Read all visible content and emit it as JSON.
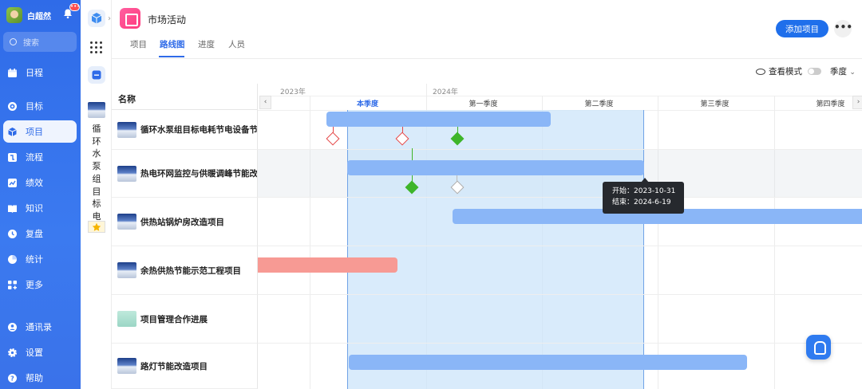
{
  "sidebar": {
    "user_name": "白超然",
    "notification_badge": "•••",
    "search_placeholder": "搜索",
    "items": [
      {
        "label": "日程",
        "icon": "calendar-icon"
      },
      {
        "label": "目标",
        "icon": "target-icon"
      },
      {
        "label": "项目",
        "icon": "cube-icon",
        "active": true
      },
      {
        "label": "流程",
        "icon": "flow-icon"
      },
      {
        "label": "绩效",
        "icon": "performance-icon"
      },
      {
        "label": "知识",
        "icon": "book-icon"
      },
      {
        "label": "复盘",
        "icon": "review-icon"
      },
      {
        "label": "统计",
        "icon": "pie-chart-icon"
      },
      {
        "label": "更多",
        "icon": "grid-plus-icon"
      },
      {
        "label": "通讯录",
        "icon": "contacts-icon"
      },
      {
        "label": "设置",
        "icon": "gear-icon"
      },
      {
        "label": "帮助",
        "icon": "help-icon"
      }
    ]
  },
  "project_column": {
    "vertical_title": "循环水泵组目标电"
  },
  "header": {
    "title": "市场活动",
    "tabs": [
      "项目",
      "路线图",
      "进度",
      "人员"
    ],
    "active_tab": "路线图",
    "add_button": "添加项目",
    "more_button": "•••"
  },
  "toolbar": {
    "view_mode_label": "查看模式",
    "view_mode_on": false,
    "scale_select": "季度"
  },
  "table": {
    "name_header": "名称",
    "rows": [
      {
        "name": "循环水泵组目标电耗节电设备节能",
        "thumb": "plane"
      },
      {
        "name": "热电环网监控与供暖调峰节能改造",
        "thumb": "plane"
      },
      {
        "name": "供热站锅炉房改造项目",
        "thumb": "plane"
      },
      {
        "name": "余热供热节能示范工程项目",
        "thumb": "plane"
      },
      {
        "name": "项目管理合作进展",
        "thumb": "cloud"
      },
      {
        "name": "路灯节能改造项目",
        "thumb": "plane"
      }
    ]
  },
  "timeline": {
    "years": [
      "2023年",
      "2024年"
    ],
    "quarters": [
      "本季度",
      "第一季度",
      "第二季度",
      "第三季度",
      "第四季度"
    ],
    "current_quarter": "本季度",
    "tooltip": {
      "start": "开始：2023-10-31",
      "end": "结束：2024-6-19"
    }
  },
  "colors": {
    "accent": "#2f6be8",
    "bar_blue": "#8ab6f7",
    "bar_red": "#f79a94",
    "milestone_green": "#3eb52a",
    "milestone_red": "#e44545"
  }
}
